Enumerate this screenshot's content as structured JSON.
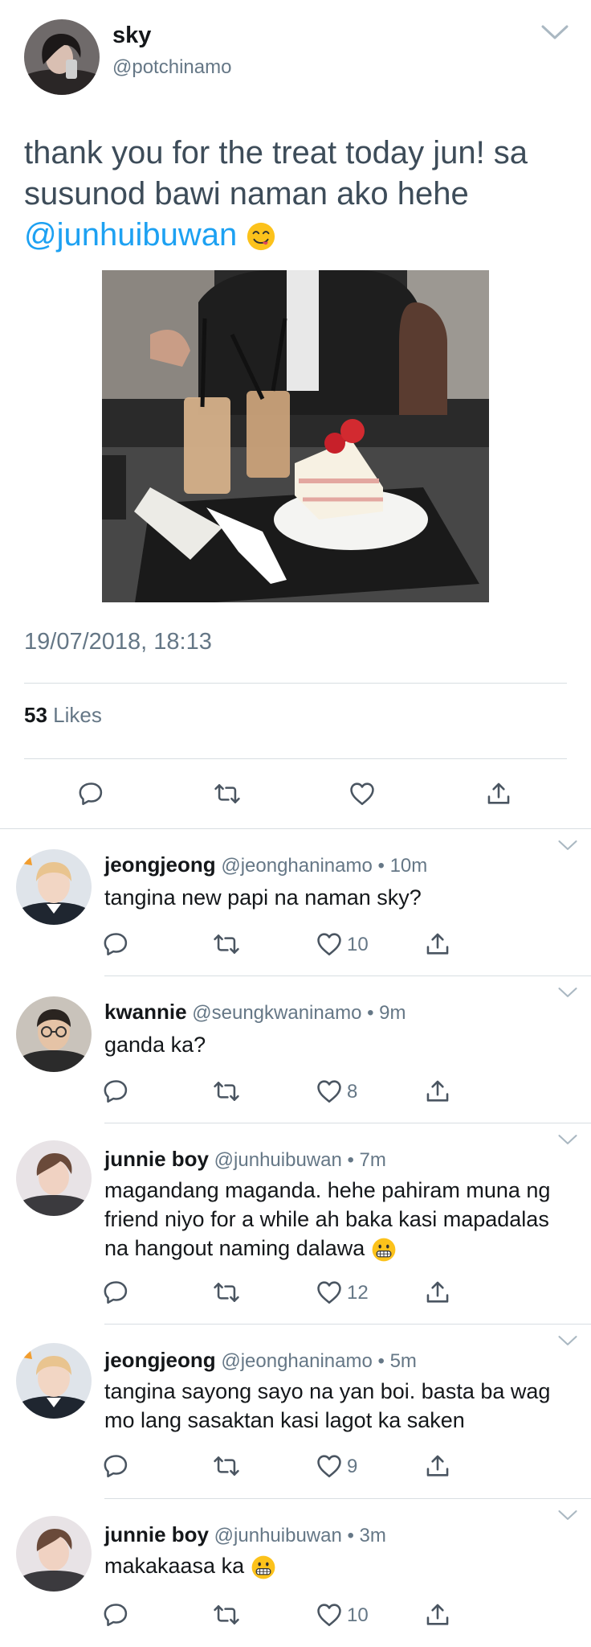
{
  "main": {
    "name": "sky",
    "handle": "@potchinamo",
    "text_plain": "thank you for the treat today jun! sa susunod bawi naman ako hehe",
    "mention": "@junhuibuwan",
    "emoji": "yummy-face-emoji",
    "timestamp": "19/07/2018, 18:13",
    "likes_count": "53",
    "likes_label": "Likes"
  },
  "replies": [
    {
      "name": "jeongjeong",
      "meta": "@jeonghaninamo • 10m",
      "text": "tangina new papi na naman sky?",
      "likes": "10"
    },
    {
      "name": "kwannie",
      "meta": "@seungkwaninamo • 9m",
      "text": "ganda ka?",
      "likes": "8"
    },
    {
      "name": "junnie boy",
      "meta": "@junhuibuwan • 7m",
      "text": "magandang maganda. hehe pahiram muna ng friend niyo for a while ah baka kasi mapadalas na hangout naming dalawa",
      "likes": "12"
    },
    {
      "name": "jeongjeong",
      "meta": "@jeonghaninamo • 5m",
      "text": "tangina sayong sayo na yan boi. basta ba wag mo lang sasaktan kasi lagot ka saken",
      "likes": "9"
    },
    {
      "name": "junnie boy",
      "meta": "@junhuibuwan • 3m",
      "text": "makakaasa ka",
      "likes": "10"
    }
  ],
  "colors": {
    "accent": "#1da1f2",
    "muted": "#657786",
    "text": "#14171a",
    "divider": "#d8dee2"
  },
  "icons": [
    "chevron-down-icon",
    "reply-icon",
    "retweet-icon",
    "heart-icon",
    "share-icon",
    "grimace-emoji"
  ]
}
